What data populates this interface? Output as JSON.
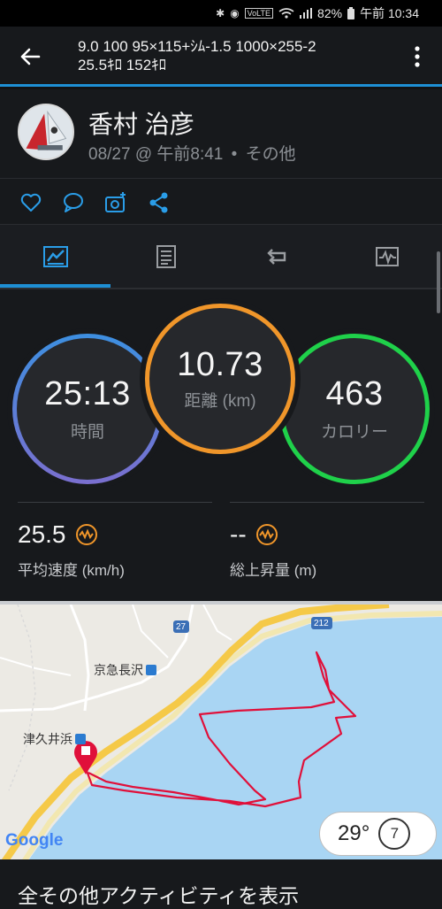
{
  "status_bar": {
    "battery": "82%",
    "time": "午前 10:34",
    "icons": [
      "bluetooth-icon",
      "nfc-icon",
      "volte-icon",
      "wifi-icon",
      "signal-icon",
      "battery-icon"
    ]
  },
  "header": {
    "title": "9.0 100 95×115+ｼﾑ-1.5 1000×255-2\n25.5ｷﾛ 152ｷﾛ"
  },
  "profile": {
    "name": "香村 治彦",
    "date": "08/27 @ 午前8:41",
    "separator": "•",
    "activity_type": "その他"
  },
  "actions": [
    "like-icon",
    "comment-icon",
    "add-photo-icon",
    "share-icon"
  ],
  "tabs": [
    {
      "name": "overview",
      "icon": "overview-icon",
      "selected": true
    },
    {
      "name": "details",
      "icon": "details-icon",
      "selected": false
    },
    {
      "name": "laps",
      "icon": "laps-icon",
      "selected": false
    },
    {
      "name": "charts",
      "icon": "chart-icon",
      "selected": false
    }
  ],
  "stats": {
    "time": {
      "value": "25:13",
      "label": "時間",
      "color": "#3d8fe0"
    },
    "distance": {
      "value": "10.73",
      "label": "距離 (km)",
      "color": "#f0962a"
    },
    "calories": {
      "value": "463",
      "label": "カロリー",
      "color": "#1fd14a"
    },
    "avg_speed": {
      "value": "25.5",
      "label": "平均速度 (km/h)"
    },
    "elevation_gain": {
      "value": "--",
      "label": "総上昇量 (m)"
    }
  },
  "map": {
    "labels": {
      "station1": "京急長沢",
      "station2": "津久井浜",
      "route_27": "27",
      "route_212": "212",
      "google": "Google"
    },
    "track_color": "#e0103a",
    "weather": {
      "temp": "29°",
      "wind": "7"
    }
  },
  "footer": {
    "link": "全その他アクティビティを表示"
  }
}
